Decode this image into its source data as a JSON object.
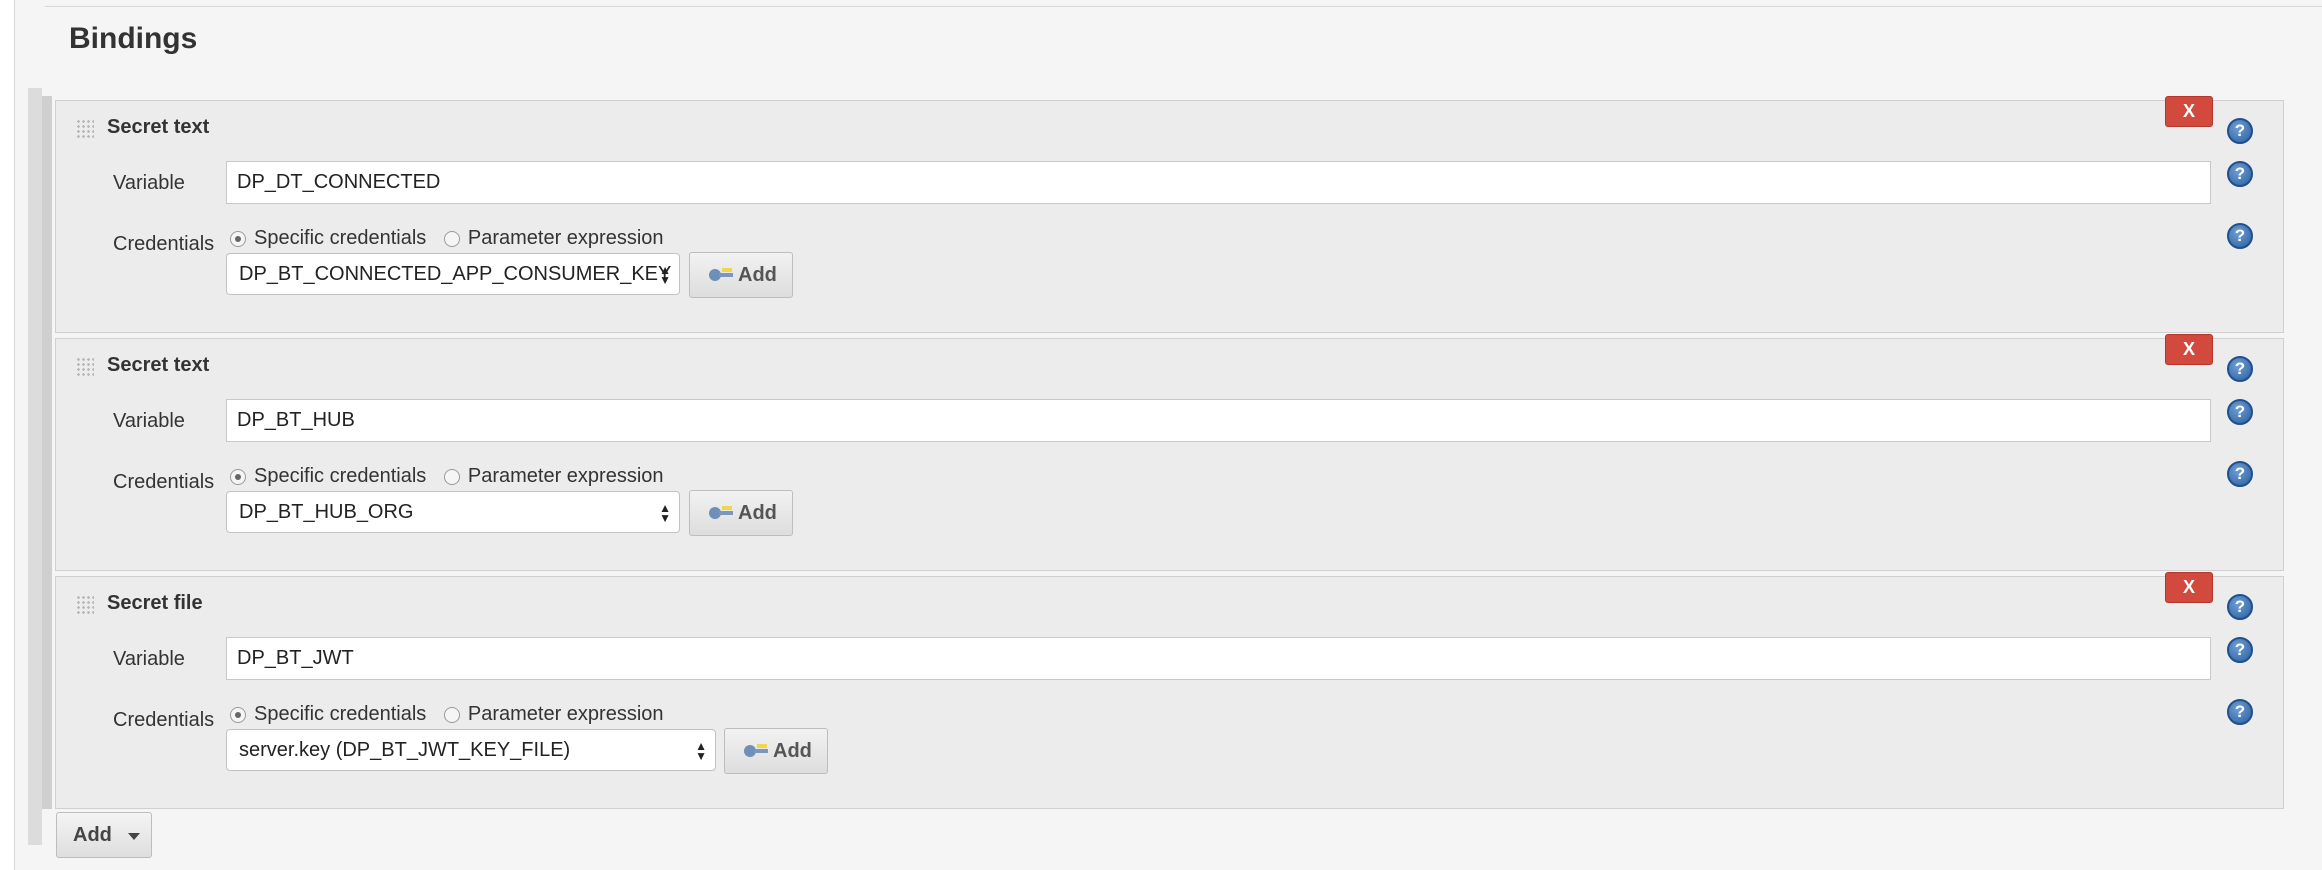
{
  "section": {
    "title": "Bindings"
  },
  "bindings": [
    {
      "type_label": "Secret text",
      "delete_label": "X",
      "variable_label": "Variable",
      "variable_value": "DP_DT_CONNECTED",
      "credentials_label": "Credentials",
      "radio_specific": "Specific credentials",
      "radio_param": "Parameter expression",
      "selected_option": "Specific credentials",
      "credential_value": "DP_BT_CONNECTED_APP_CONSUMER_KEY",
      "add_label": "Add"
    },
    {
      "type_label": "Secret text",
      "delete_label": "X",
      "variable_label": "Variable",
      "variable_value": "DP_BT_HUB",
      "credentials_label": "Credentials",
      "radio_specific": "Specific credentials",
      "radio_param": "Parameter expression",
      "selected_option": "Specific credentials",
      "credential_value": "DP_BT_HUB_ORG",
      "add_label": "Add"
    },
    {
      "type_label": "Secret file",
      "delete_label": "X",
      "variable_label": "Variable",
      "variable_value": "DP_BT_JWT",
      "credentials_label": "Credentials",
      "radio_specific": "Specific credentials",
      "radio_param": "Parameter expression",
      "selected_option": "Specific credentials",
      "credential_value": "server.key (DP_BT_JWT_KEY_FILE)",
      "add_label": "Add"
    }
  ],
  "help_glyph": "?",
  "footer": {
    "add_label": "Add"
  },
  "icons": {
    "delete": "close-icon",
    "help": "help-icon",
    "drag": "drag-handle-icon",
    "credential_add": "key-icon",
    "dropdown": "chevron-down-icon"
  },
  "colors": {
    "delete_button": "#d24a3d",
    "help_icon": "#2c5f9e",
    "panel_background": "#ececec"
  }
}
